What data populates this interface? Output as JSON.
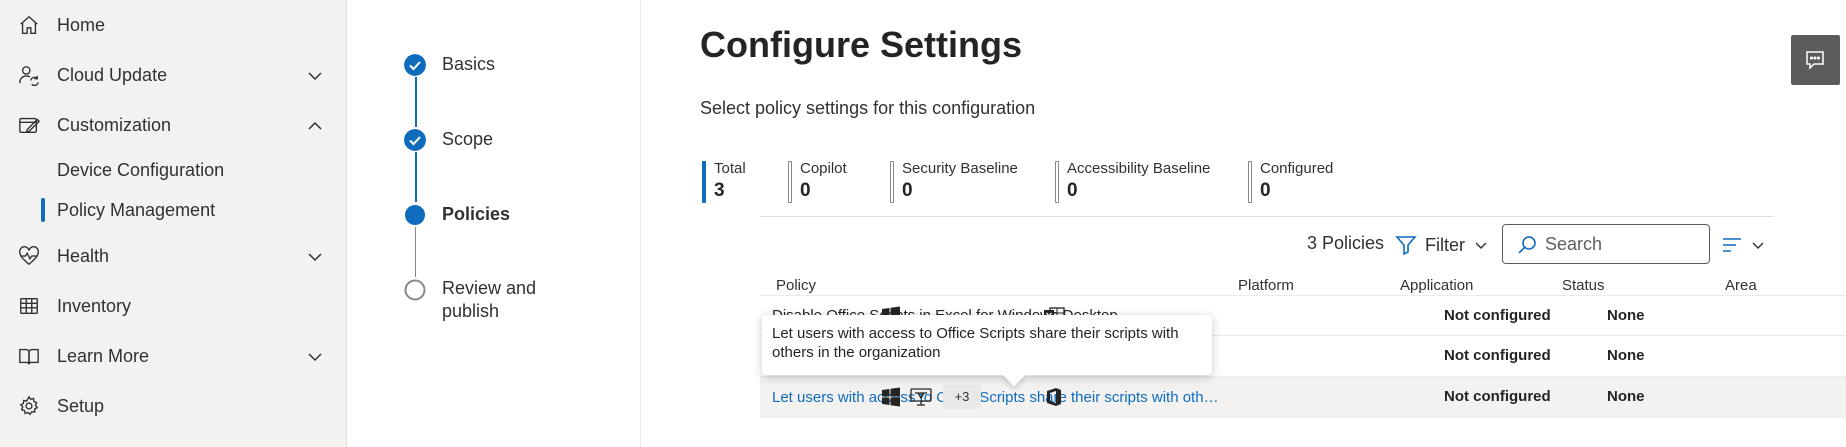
{
  "nav": {
    "items": [
      {
        "label": "Home",
        "icon": "home-icon"
      },
      {
        "label": "Cloud Update",
        "icon": "person-sync-icon"
      },
      {
        "label": "Customization",
        "icon": "edit-window-icon"
      },
      {
        "label": "Health",
        "icon": "heart-pulse-icon"
      },
      {
        "label": "Inventory",
        "icon": "table-icon"
      },
      {
        "label": "Learn More",
        "icon": "book-icon"
      },
      {
        "label": "Setup",
        "icon": "gear-icon"
      }
    ],
    "sub_items": [
      {
        "label": "Device Configuration"
      },
      {
        "label": "Policy Management",
        "selected": true
      }
    ]
  },
  "steps": [
    {
      "label": "Basics",
      "state": "completed"
    },
    {
      "label": "Scope",
      "state": "completed"
    },
    {
      "label": "Policies",
      "state": "current"
    },
    {
      "label": "Review and",
      "label2": "publish",
      "state": "pending"
    }
  ],
  "main": {
    "title": "Configure Settings",
    "subtitle": "Select policy settings for this configuration",
    "stats": [
      {
        "label": "Total",
        "value": "3"
      },
      {
        "label": "Copilot",
        "value": "0"
      },
      {
        "label": "Security Baseline",
        "value": "0"
      },
      {
        "label": "Accessibility Baseline",
        "value": "0"
      },
      {
        "label": "Configured",
        "value": "0"
      }
    ],
    "toolbar": {
      "count": "3 Policies",
      "filter_label": "Filter",
      "search_placeholder": "Search"
    },
    "table": {
      "headers": [
        "Policy",
        "Platform",
        "Application",
        "Status",
        "Area"
      ],
      "rows": [
        {
          "policy": "Disable Office Scripts in Excel for Windows Desktop",
          "platform_more": "",
          "status": "Not configured",
          "area": "None"
        },
        {
          "policy": "Let users with access to Office Scripts share their scripts with others in the organization",
          "platform_more": "+3",
          "status": "Not configured",
          "area": "None"
        },
        {
          "policy": "Let users with access to Office Scripts share their scripts with others in the organization",
          "platform_more": "+3",
          "status": "Not configured",
          "area": "None"
        }
      ]
    },
    "tooltip": {
      "text": "Let users with access to Office Scripts share their scripts with others in the organization"
    }
  },
  "colors": {
    "accent": "#0f6cbd",
    "nav_bg": "#f3f2f1",
    "feedback_bg": "#5c5c5c"
  }
}
